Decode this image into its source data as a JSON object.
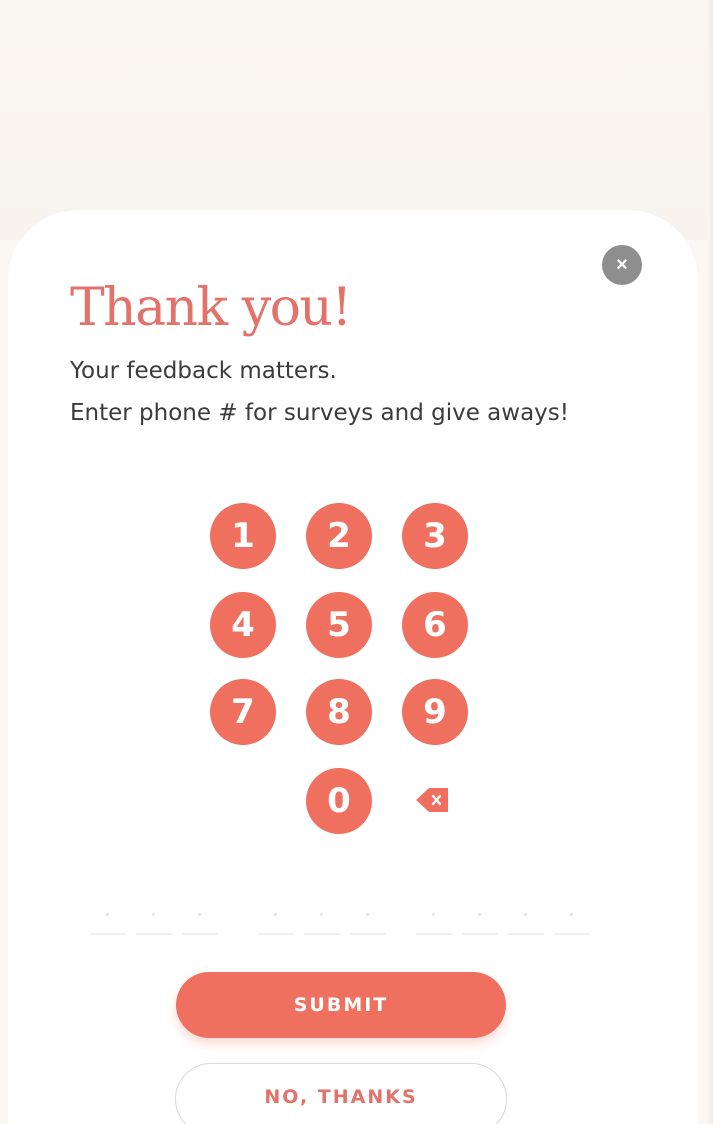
{
  "dialog": {
    "title": "Thank you!",
    "subtitle": "Your feedback matters.",
    "prompt": "Enter phone # for surveys and give aways!",
    "close_icon": "close-icon"
  },
  "keypad": {
    "keys": [
      "1",
      "2",
      "3",
      "4",
      "5",
      "6",
      "7",
      "8",
      "9",
      "0"
    ],
    "backspace_icon": "backspace-icon"
  },
  "phone_input": {
    "value": "",
    "digit_count": 10
  },
  "actions": {
    "submit_label": "SUBMIT",
    "decline_label": "NO, THANKS"
  },
  "colors": {
    "accent": "#f0705f",
    "title": "#e2726a",
    "close_button": "#8e8e8e",
    "background": "#fbf7f3"
  }
}
